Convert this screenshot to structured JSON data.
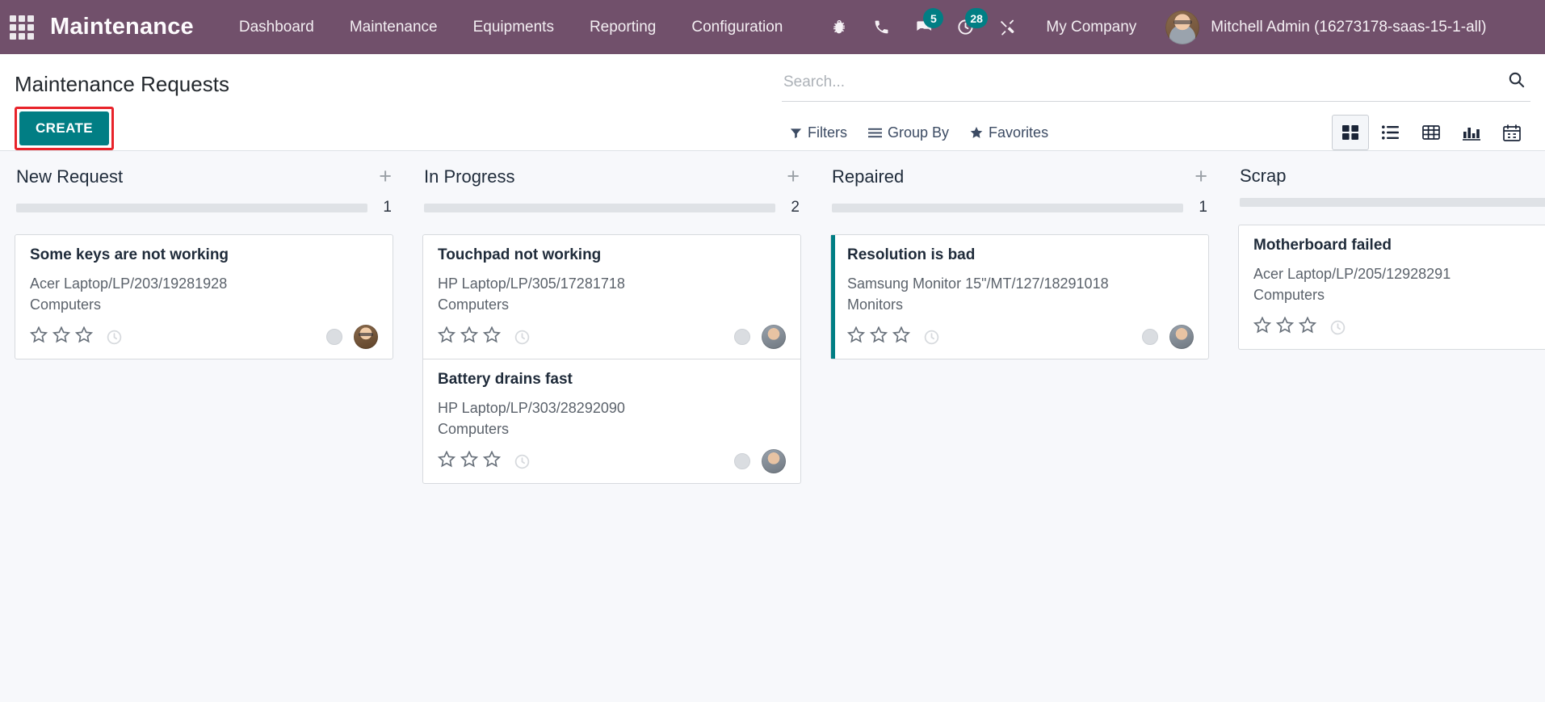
{
  "navbar": {
    "apps_icon": "apps-grid-icon",
    "brand": "Maintenance",
    "menu": [
      {
        "label": "Dashboard"
      },
      {
        "label": "Maintenance"
      },
      {
        "label": "Equipments"
      },
      {
        "label": "Reporting"
      },
      {
        "label": "Configuration"
      }
    ],
    "icons": [
      {
        "name": "bug-icon",
        "badge": ""
      },
      {
        "name": "phone-icon",
        "badge": ""
      },
      {
        "name": "messages-icon",
        "badge": "5"
      },
      {
        "name": "activities-clock-icon",
        "badge": "28"
      },
      {
        "name": "tools-icon",
        "badge": ""
      }
    ],
    "company": "My Company",
    "user_name": "Mitchell Admin (16273178-saas-15-1-all)",
    "bg_color": "#71506b",
    "badge_color": "#017e84"
  },
  "control_panel": {
    "page_title": "Maintenance Requests",
    "create_label": "CREATE",
    "create_color": "#017e84",
    "highlight_color": "#e8232a",
    "search_placeholder": "Search...",
    "search_value": "",
    "search_icon": "search-icon",
    "filter_buttons": [
      {
        "label": "Filters",
        "icon": "funnel-icon"
      },
      {
        "label": "Group By",
        "icon": "list-lines-icon"
      },
      {
        "label": "Favorites",
        "icon": "star-icon"
      }
    ],
    "views": [
      {
        "name": "kanban-view",
        "icon": "kanban-icon",
        "active": true
      },
      {
        "name": "list-view",
        "icon": "list-icon",
        "active": false
      },
      {
        "name": "pivot-view",
        "icon": "table-icon",
        "active": false
      },
      {
        "name": "graph-view",
        "icon": "bar-chart-icon",
        "active": false
      },
      {
        "name": "calendar-view",
        "icon": "calendar-icon",
        "active": false
      }
    ]
  },
  "kanban": {
    "columns": [
      {
        "title": "New Request",
        "count": "1",
        "has_add": true,
        "cards": [
          {
            "title": "Some keys are not working",
            "equipment": "Acer Laptop/LP/203/19281928",
            "category": "Computers",
            "stars": 3,
            "stars_filled": 0,
            "accent": false,
            "avatar": "a1"
          }
        ]
      },
      {
        "title": "In Progress",
        "count": "2",
        "has_add": true,
        "cards": [
          {
            "title": "Touchpad not working",
            "equipment": "HP Laptop/LP/305/17281718",
            "category": "Computers",
            "stars": 3,
            "stars_filled": 0,
            "accent": false,
            "avatar": "a2"
          },
          {
            "title": "Battery drains fast",
            "equipment": "HP Laptop/LP/303/28292090",
            "category": "Computers",
            "stars": 3,
            "stars_filled": 0,
            "accent": false,
            "avatar": "a2"
          }
        ]
      },
      {
        "title": "Repaired",
        "count": "1",
        "has_add": true,
        "cards": [
          {
            "title": "Resolution is bad",
            "equipment": "Samsung Monitor 15\"/MT/127/18291018",
            "category": "Monitors",
            "stars": 3,
            "stars_filled": 0,
            "accent": true,
            "accent_color": "#017e84",
            "avatar": "a2"
          }
        ]
      },
      {
        "title": "Scrap",
        "count": "",
        "has_add": false,
        "cards": [
          {
            "title": "Motherboard failed",
            "equipment": "Acer Laptop/LP/205/12928291",
            "category": "Computers",
            "stars": 3,
            "stars_filled": 0,
            "accent": false,
            "avatar": "a1"
          }
        ]
      }
    ]
  }
}
